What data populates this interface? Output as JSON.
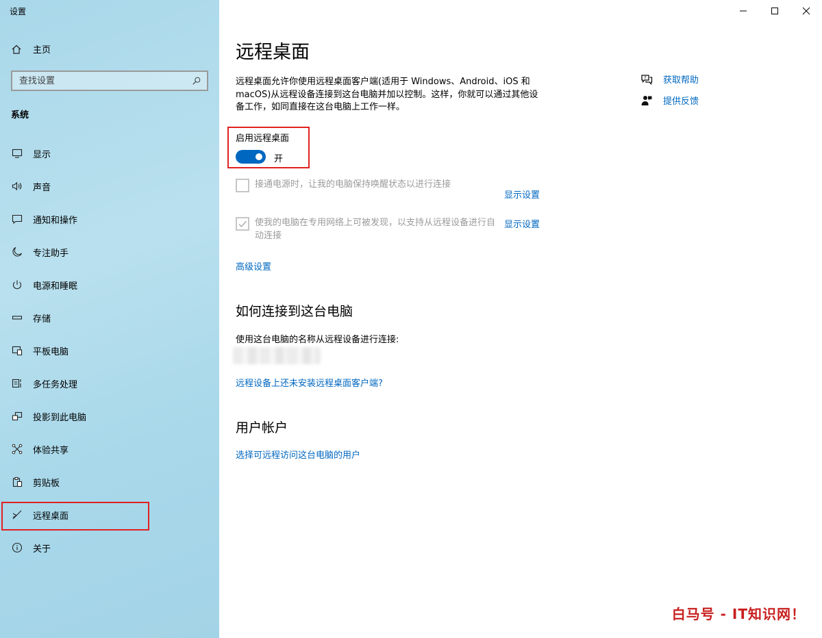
{
  "app": {
    "title": "设置"
  },
  "sidebar": {
    "home_label": "主页",
    "search_placeholder": "查找设置",
    "section_label": "系统",
    "items": [
      {
        "label": "显示",
        "icon": "monitor-icon"
      },
      {
        "label": "声音",
        "icon": "speaker-icon"
      },
      {
        "label": "通知和操作",
        "icon": "notification-icon"
      },
      {
        "label": "专注助手",
        "icon": "moon-icon"
      },
      {
        "label": "电源和睡眠",
        "icon": "power-icon"
      },
      {
        "label": "存储",
        "icon": "storage-icon"
      },
      {
        "label": "平板电脑",
        "icon": "tablet-icon"
      },
      {
        "label": "多任务处理",
        "icon": "multitask-icon"
      },
      {
        "label": "投影到此电脑",
        "icon": "project-icon"
      },
      {
        "label": "体验共享",
        "icon": "share-icon"
      },
      {
        "label": "剪贴板",
        "icon": "clipboard-icon"
      },
      {
        "label": "远程桌面",
        "icon": "remote-desktop-icon",
        "active": true
      },
      {
        "label": "关于",
        "icon": "info-icon"
      }
    ]
  },
  "main": {
    "title": "远程桌面",
    "description": "远程桌面允许你使用远程桌面客户端(适用于 Windows、Android、iOS 和 macOS)从远程设备连接到这台电脑并加以控制。这样，你就可以通过其他设备工作，如同直接在这台电脑上工作一样。",
    "enable_label": "启用远程桌面",
    "toggle_state": "开",
    "toggle_on": true,
    "checkbox1": {
      "label": "接通电源时，让我的电脑保持唤醒状态以进行连接",
      "checked": false,
      "link": "显示设置"
    },
    "checkbox2": {
      "label": "使我的电脑在专用网络上可被发现，以支持从远程设备进行自动连接",
      "checked": true,
      "link": "显示设置"
    },
    "advanced_link": "高级设置",
    "connect_heading": "如何连接到这台电脑",
    "connect_text": "使用这台电脑的名称从远程设备进行连接:",
    "client_link": "远程设备上还未安装远程桌面客户端?",
    "accounts_heading": "用户帐户",
    "accounts_link": "选择可远程访问这台电脑的用户"
  },
  "help": {
    "get_help": "获取帮助",
    "feedback": "提供反馈"
  },
  "watermark": "白马号 - IT知识网！",
  "colors": {
    "accent": "#0067c0",
    "highlight": "#e02020",
    "sidebar_bg": "#a9d8ea"
  }
}
